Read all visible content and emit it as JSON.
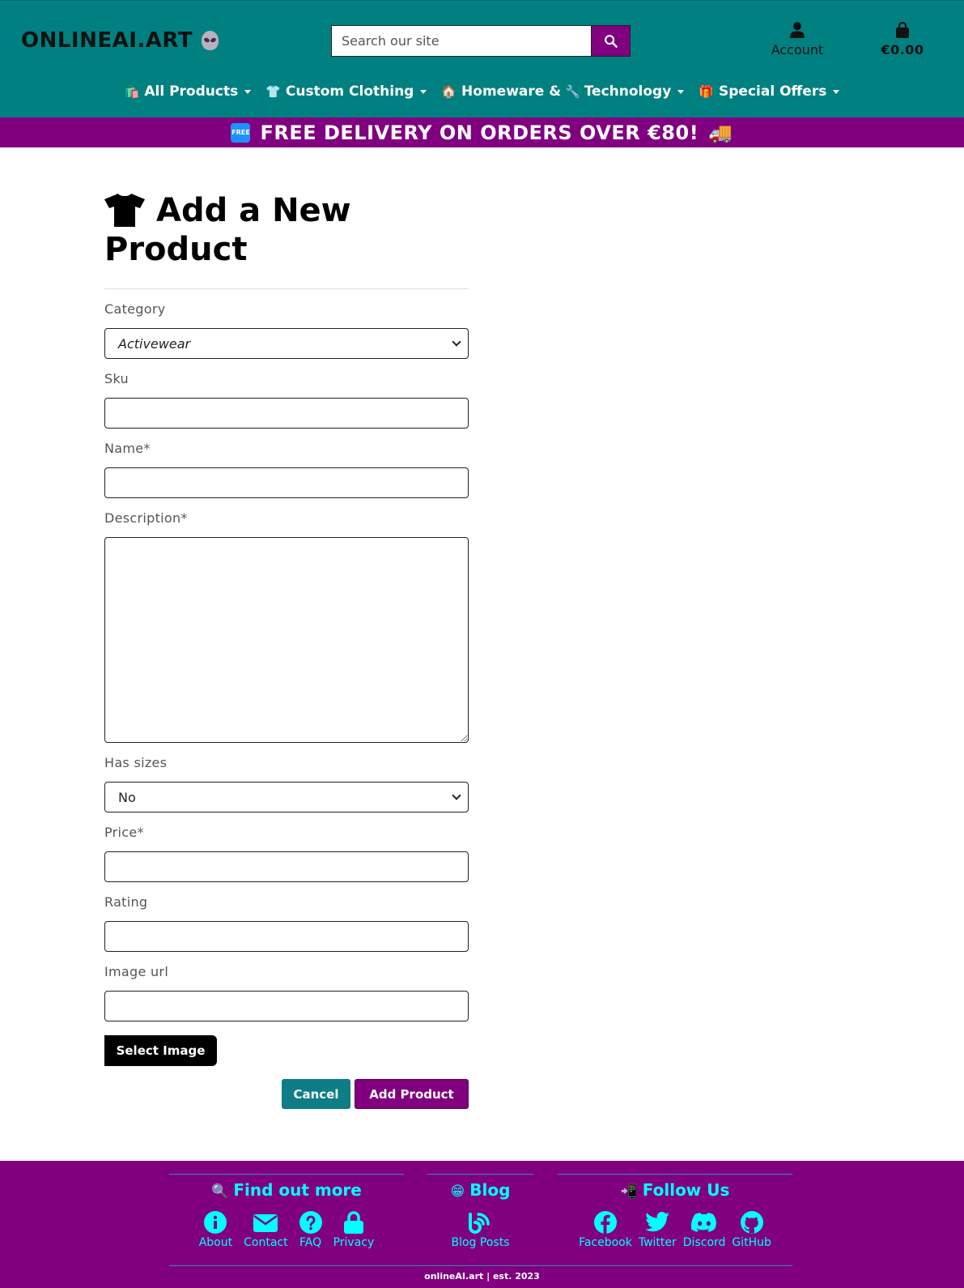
{
  "header": {
    "logo_text": "ONLINEAI.ART",
    "search_placeholder": "Search our site",
    "account_label": "Account",
    "bag_total": "€0.00"
  },
  "nav": {
    "items": [
      {
        "emoji": "🛍️",
        "label": "All Products"
      },
      {
        "emoji": "👕",
        "label": "Custom Clothing"
      },
      {
        "emoji": "🏠",
        "label": "Homeware &",
        "emoji2": "🔧",
        "label2": "Technology"
      },
      {
        "emoji": "🎁",
        "label": "Special Offers"
      }
    ]
  },
  "promo": {
    "badge": "FREE",
    "text": "FREE DELIVERY ON ORDERS OVER €80!",
    "emoji_end": "🚚"
  },
  "form": {
    "title_line1": "Add a New",
    "title_line2": "Product",
    "category_label": "Category",
    "category_value": "Activewear",
    "sku_label": "Sku",
    "name_label": "Name*",
    "description_label": "Description*",
    "has_sizes_label": "Has sizes",
    "has_sizes_value": "No",
    "price_label": "Price*",
    "rating_label": "Rating",
    "image_url_label": "Image url",
    "select_image_label": "Select Image",
    "cancel_label": "Cancel",
    "submit_label": "Add Product"
  },
  "footer": {
    "find_out_more": {
      "emoji": "🔍",
      "title": "Find out more",
      "links": [
        "About",
        "Contact",
        "FAQ",
        "Privacy"
      ]
    },
    "blog": {
      "emoji": "😁",
      "title": "Blog",
      "links": [
        "Blog Posts"
      ]
    },
    "follow_us": {
      "emoji": "📲",
      "title": "Follow Us",
      "links": [
        "Facebook",
        "Twitter",
        "Discord",
        "GitHub"
      ]
    },
    "copyright": "onlineAI.art | est. 2023"
  },
  "colors": {
    "header_bg": "#008080",
    "brand_purple": "#800080",
    "footer_text": "#00ffff",
    "cancel_teal": "#0e7d85"
  }
}
